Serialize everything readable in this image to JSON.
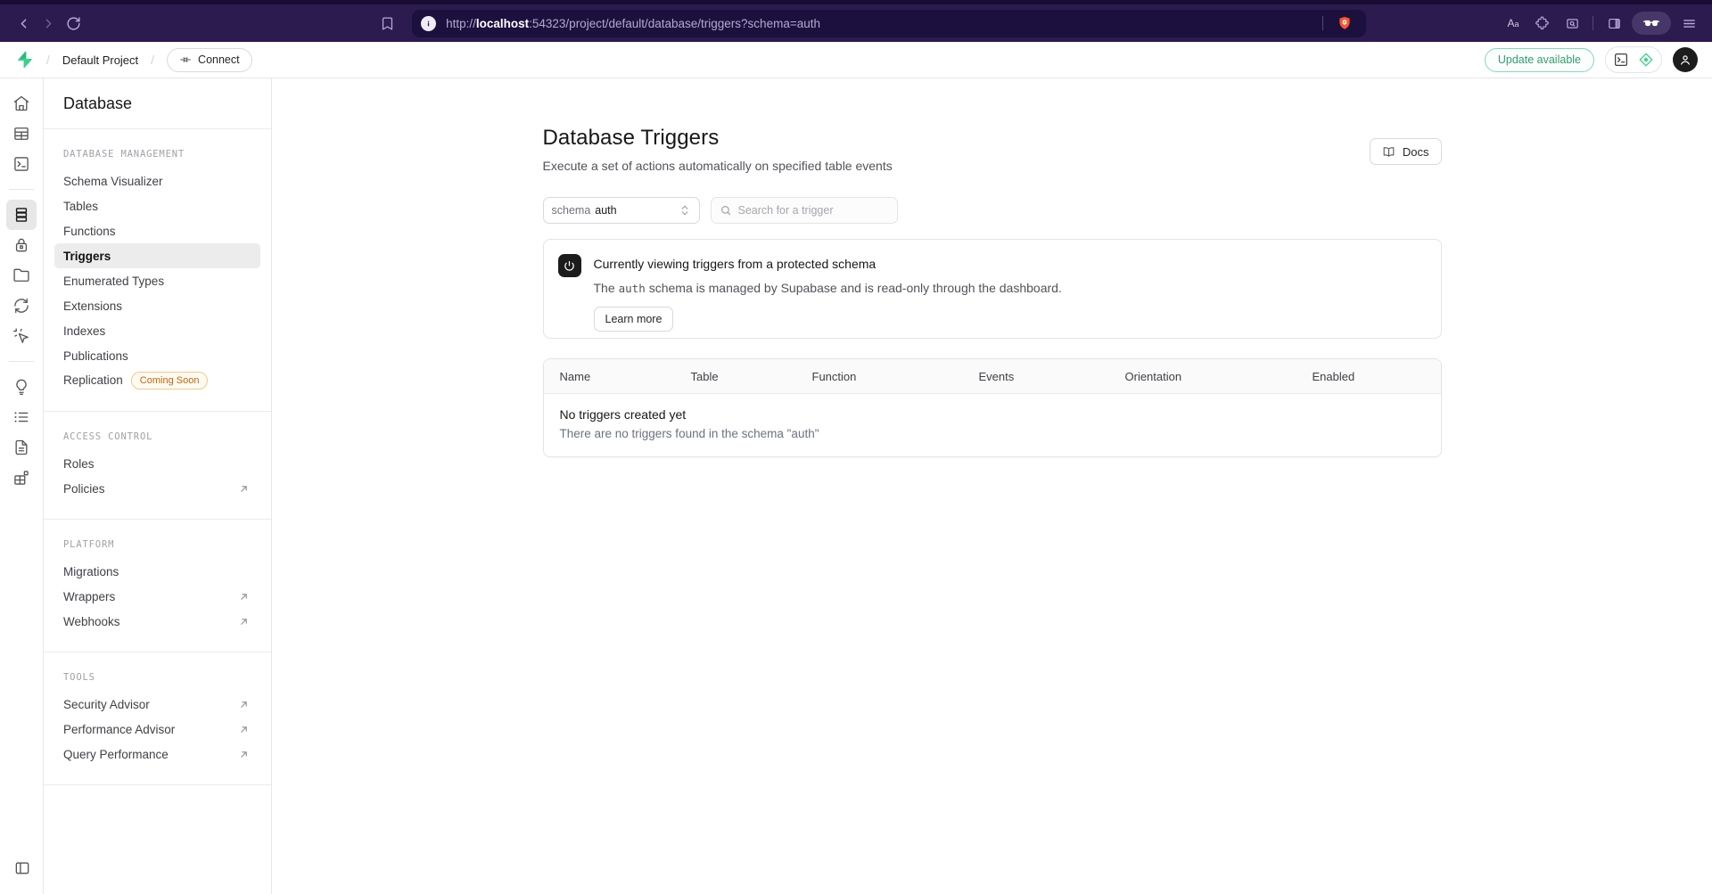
{
  "browser": {
    "url": {
      "protocol": "http://",
      "host": "localhost",
      "rest": ":54323/project/default/database/triggers?schema=auth"
    }
  },
  "header": {
    "project": "Default Project",
    "sep1": "/",
    "sep2": "/",
    "connect": "Connect",
    "update": "Update available"
  },
  "sidebar": {
    "title": "Database",
    "sections": [
      {
        "header": "DATABASE MANAGEMENT",
        "items": [
          {
            "label": "Schema Visualizer"
          },
          {
            "label": "Tables"
          },
          {
            "label": "Functions"
          },
          {
            "label": "Triggers"
          },
          {
            "label": "Enumerated Types"
          },
          {
            "label": "Extensions"
          },
          {
            "label": "Indexes"
          },
          {
            "label": "Publications"
          },
          {
            "label": "Replication",
            "badge": "Coming Soon"
          }
        ]
      },
      {
        "header": "ACCESS CONTROL",
        "items": [
          {
            "label": "Roles"
          },
          {
            "label": "Policies"
          }
        ]
      },
      {
        "header": "PLATFORM",
        "items": [
          {
            "label": "Migrations"
          },
          {
            "label": "Wrappers"
          },
          {
            "label": "Webhooks"
          }
        ]
      },
      {
        "header": "TOOLS",
        "items": [
          {
            "label": "Security Advisor"
          },
          {
            "label": "Performance Advisor"
          },
          {
            "label": "Query Performance"
          }
        ]
      }
    ]
  },
  "main": {
    "title": "Database Triggers",
    "subtitle": "Execute a set of actions automatically on specified table events",
    "docs": "Docs",
    "schema_label": "schema",
    "schema_value": "auth",
    "search_placeholder": "Search for a trigger",
    "banner": {
      "title": "Currently viewing triggers from a protected schema",
      "body_pre": "The",
      "code": "auth",
      "body_post": "schema is managed by Supabase and is read-only through the dashboard.",
      "action": "Learn more"
    },
    "table": {
      "columns": [
        "Name",
        "Table",
        "Function",
        "Events",
        "Orientation",
        "Enabled"
      ],
      "empty_title": "No triggers created yet",
      "empty_subtitle": "There are no triggers found in the schema \"auth\""
    }
  },
  "colors": {
    "brand_green": "#3ecf8e",
    "update_green": "#2e9e6e",
    "badge_orange": "#c2660a",
    "browser_toolbar": "#2c1b4e",
    "browser_urlbar": "#1c103f",
    "brave_shield": "#fb542b",
    "selected_item_bg": "#ececec"
  }
}
